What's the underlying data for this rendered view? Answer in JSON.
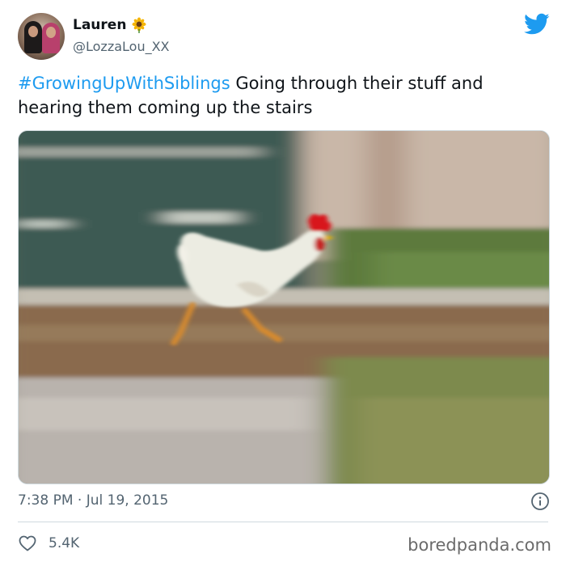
{
  "author": {
    "display_name": "Lauren",
    "handle": "@LozzaLou_XX",
    "avatar_icon": "profile-photo-two-women",
    "name_emoji_icon": "sunflower-icon"
  },
  "brand": {
    "logo_icon": "twitter-bird-icon",
    "color": "#1d9bf0"
  },
  "tweet": {
    "hashtag": "#GrowingUpWithSiblings",
    "text": " Going through their stuff and hearing them coming up the stairs",
    "timestamp": "7:38 PM · Jul 19, 2015",
    "likes_count": "5.4K"
  },
  "media": {
    "type": "photo"
  },
  "footer": {
    "watermark": "boredpanda.com"
  }
}
